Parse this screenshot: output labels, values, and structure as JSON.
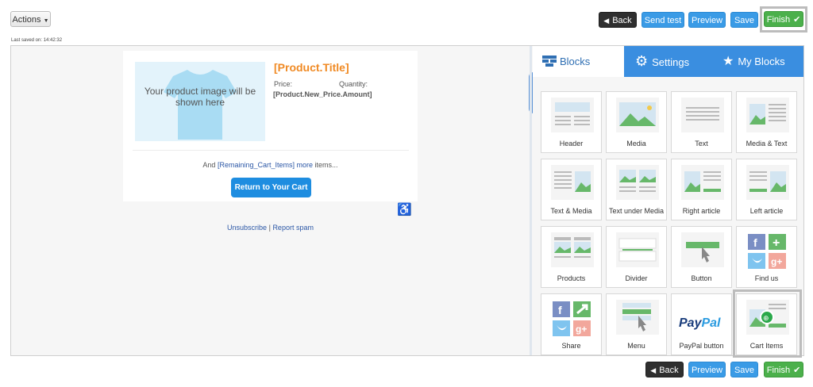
{
  "toolbar": {
    "actions_label": "Actions",
    "back_label": "Back",
    "send_test_label": "Send test",
    "preview_label": "Preview",
    "save_label": "Save",
    "finish_label": "Finish"
  },
  "status": {
    "last_saved": "Last saved on: 14:42:32"
  },
  "email": {
    "image_placeholder": "Your product image will be shown here",
    "product_title": "[Product.Title]",
    "price_label": "Price:",
    "quantity_label": "Quantity:",
    "price_value": "[Product.New_Price.Amount]",
    "remaining_prefix": "And",
    "remaining_link": "[Remaining_Cart_Items]",
    "remaining_more": "more",
    "remaining_suffix": "items...",
    "return_button": "Return to Your Cart",
    "unsubscribe": "Unsubscribe",
    "separator": "|",
    "report_spam": "Report spam"
  },
  "panel": {
    "tabs": [
      {
        "label": "Blocks",
        "icon": "blocks-icon"
      },
      {
        "label": "Settings",
        "icon": "gear-icon"
      },
      {
        "label": "My Blocks",
        "icon": "star-icon"
      }
    ],
    "blocks": [
      {
        "label": "Header"
      },
      {
        "label": "Media"
      },
      {
        "label": "Text"
      },
      {
        "label": "Media & Text"
      },
      {
        "label": "Text & Media"
      },
      {
        "label": "Text under Media"
      },
      {
        "label": "Right article"
      },
      {
        "label": "Left article"
      },
      {
        "label": "Products"
      },
      {
        "label": "Divider"
      },
      {
        "label": "Button"
      },
      {
        "label": "Find us"
      },
      {
        "label": "Share"
      },
      {
        "label": "Menu"
      },
      {
        "label": "PayPal button",
        "logo_pay": "Pay",
        "logo_pal": "Pal"
      },
      {
        "label": "Cart Items"
      }
    ]
  },
  "footer_toolbar": {
    "back_label": "Back",
    "preview_label": "Preview",
    "save_label": "Save",
    "finish_label": "Finish"
  },
  "colors": {
    "accent_blue": "#3a9be6",
    "finish_green": "#4bb04b",
    "title_orange": "#f08a24",
    "tab_bar_blue": "#3a8ee0"
  }
}
